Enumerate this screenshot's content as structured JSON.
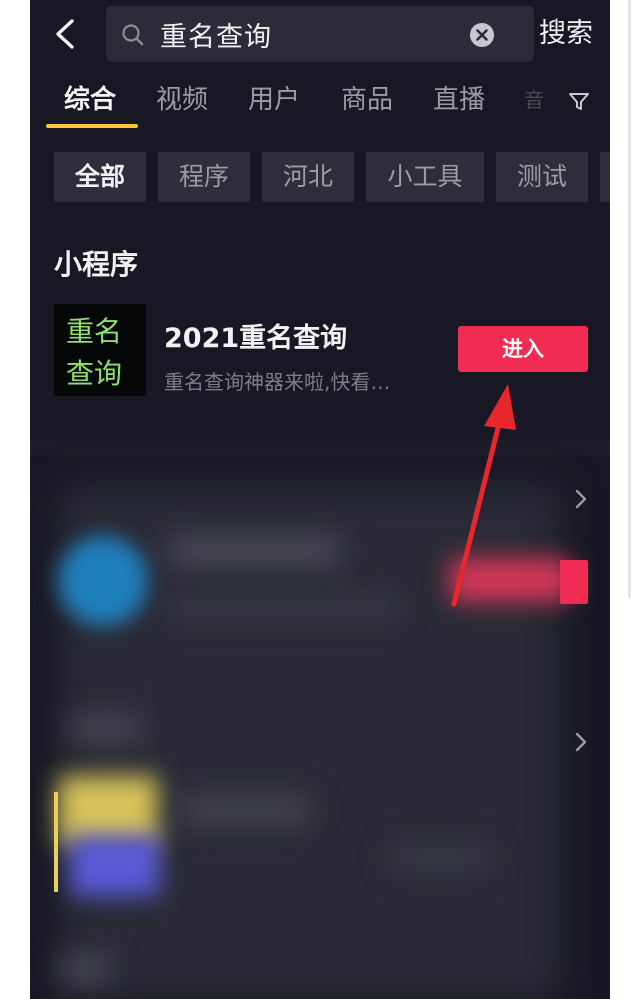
{
  "search": {
    "query": "重名查询",
    "button_label": "搜索"
  },
  "tabs": [
    {
      "label": "综合",
      "active": true
    },
    {
      "label": "视频",
      "active": false
    },
    {
      "label": "用户",
      "active": false
    },
    {
      "label": "商品",
      "active": false
    },
    {
      "label": "直播",
      "active": false
    },
    {
      "label": "音",
      "active": false
    }
  ],
  "chips": [
    {
      "label": "全部",
      "active": true
    },
    {
      "label": "程序",
      "active": false
    },
    {
      "label": "河北",
      "active": false
    },
    {
      "label": "小工具",
      "active": false
    },
    {
      "label": "测试",
      "active": false
    }
  ],
  "mini_program": {
    "section_title": "小程序",
    "logo_text": [
      "重名",
      "查询"
    ],
    "name": "2021重名查询",
    "description": "重名查询神器来啦,快看…",
    "enter_label": "进入"
  },
  "colors": {
    "background": "#171823",
    "accent_red": "#f12c53",
    "tab_underline": "#f7c631",
    "logo_text": "#8ee06a",
    "arrow": "#e8262d"
  },
  "icons": [
    "back-icon",
    "search-icon",
    "clear-icon",
    "filter-icon",
    "chevron-right-icon"
  ]
}
